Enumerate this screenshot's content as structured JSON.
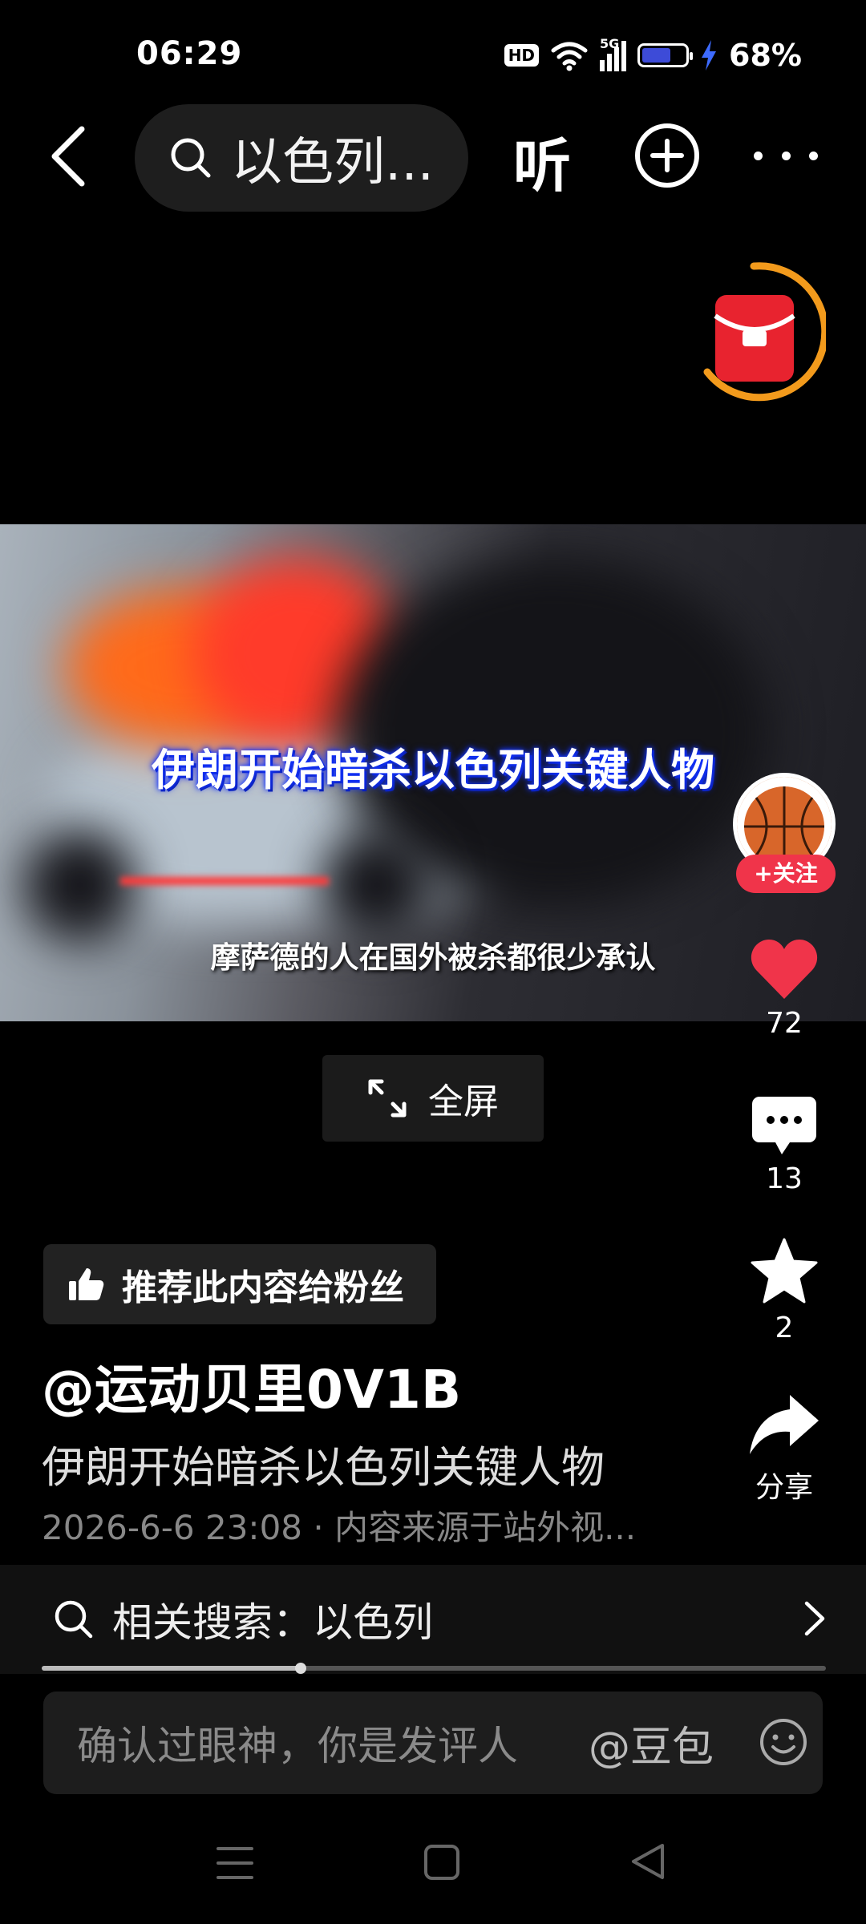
{
  "status_bar": {
    "time": "06:29",
    "hd_badge": "HD",
    "network": "5G",
    "battery_percent": "68%",
    "battery_level": 0.68
  },
  "nav": {
    "search_text": "以色列...",
    "listen_label": "听"
  },
  "video": {
    "overlay_title": "伊朗开始暗杀以色列关键人物",
    "subtitle": "摩萨德的人在国外被杀都很少承认"
  },
  "fullscreen_label": "全屏",
  "actions": {
    "follow_label": "+关注",
    "like_count": "72",
    "comment_count": "13",
    "favorite_count": "2",
    "share_label": "分享"
  },
  "recommend_label": "推荐此内容给粉丝",
  "post": {
    "author": "@运动贝里0V1B",
    "description": "伊朗开始暗杀以色列关键人物",
    "meta": "2026-6-6 23:08 · 内容来源于站外视..."
  },
  "related_search": {
    "label": "相关搜索：以色列"
  },
  "playback_progress": 0.33,
  "comment_box": {
    "placeholder": "确认过眼神，你是发评人",
    "mention": "@豆包"
  },
  "colors": {
    "accent_red": "#f0344a",
    "battery_blue": "#3d4bd8",
    "ring_orange": "#f29a1c"
  }
}
